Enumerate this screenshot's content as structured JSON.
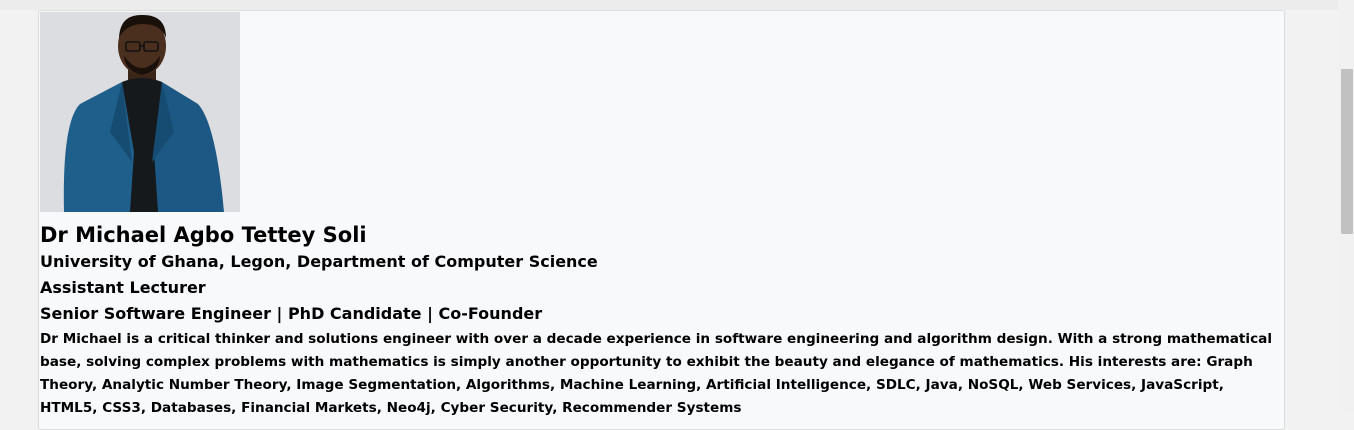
{
  "profile": {
    "photo_icon": "portrait-photo",
    "name": "Dr Michael Agbo Tettey Soli",
    "affiliation": "University of Ghana, Legon, Department of Computer Science",
    "position": "Assistant Lecturer",
    "roles": "Senior Software Engineer | PhD Candidate | Co-Founder",
    "bio": "Dr Michael is a critical thinker and solutions engineer with over a decade experience in software engineering and algorithm design. With a strong mathematical base, solving complex problems with mathematics is simply another opportunity to exhibit the beauty and elegance of mathematics. His interests are: Graph Theory, Analytic Number Theory, Image Segmentation, Algorithms, Machine Learning, Artificial Intelligence, SDLC, Java, NoSQL, Web Services, JavaScript, HTML5, CSS3, Databases, Financial Markets, Neo4j, Cyber Security, Recommender Systems"
  },
  "colors": {
    "card_background": "#f8f9fb",
    "page_background": "#f2f2f2",
    "jacket": "#1f5f8b",
    "text": "#000000"
  }
}
